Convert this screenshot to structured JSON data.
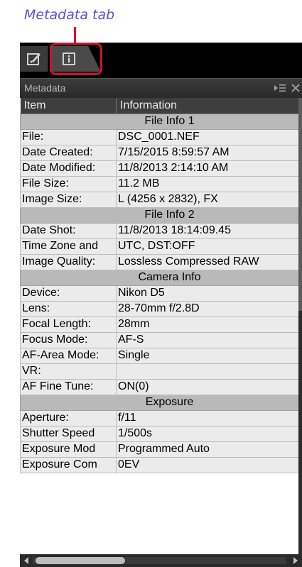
{
  "callout": {
    "label": "Metadata tab",
    "color": "#5a4fd8",
    "highlight_color": "#d4102c"
  },
  "tabs": [
    {
      "icon": "edit-adjust-icon",
      "active": false
    },
    {
      "icon": "info-icon",
      "active": true
    }
  ],
  "panel": {
    "title": "Metadata",
    "menu_icon": "panel-menu-icon",
    "close_icon": "close-icon"
  },
  "table": {
    "headers": [
      "Item",
      "Information"
    ],
    "rows": [
      {
        "section": "File Info 1"
      },
      {
        "item": "File:",
        "info": "DSC_0001.NEF"
      },
      {
        "item": "Date Created:",
        "info": "7/15/2015 8:59:57 AM"
      },
      {
        "item": "Date Modified:",
        "info": "11/8/2013 2:14:10 AM"
      },
      {
        "item": "File Size:",
        "info": "11.2 MB"
      },
      {
        "item": "Image Size:",
        "info": "L (4256 x 2832), FX"
      },
      {
        "section": "File Info 2"
      },
      {
        "item": "Date Shot:",
        "info": "11/8/2013 18:14:09.45"
      },
      {
        "item": "Time Zone and",
        "info": "UTC, DST:OFF"
      },
      {
        "item": "Image Quality:",
        "info": "Lossless Compressed RAW"
      },
      {
        "section": "Camera Info"
      },
      {
        "item": "Device:",
        "info": "Nikon D5"
      },
      {
        "item": "Lens:",
        "info": "28-70mm f/2.8D"
      },
      {
        "item": "Focal Length:",
        "info": "28mm"
      },
      {
        "item": "Focus Mode:",
        "info": "AF-S"
      },
      {
        "item": "AF-Area Mode:",
        "info": "Single"
      },
      {
        "item": "VR:",
        "info": ""
      },
      {
        "item": "AF Fine Tune:",
        "info": "ON(0)"
      },
      {
        "section": "Exposure"
      },
      {
        "item": "Aperture:",
        "info": "f/11"
      },
      {
        "item": "Shutter Speed",
        "info": "1/500s"
      },
      {
        "item": "Exposure Mod",
        "info": "Programmed Auto"
      },
      {
        "item": "Exposure Com",
        "info": "0EV"
      }
    ]
  }
}
